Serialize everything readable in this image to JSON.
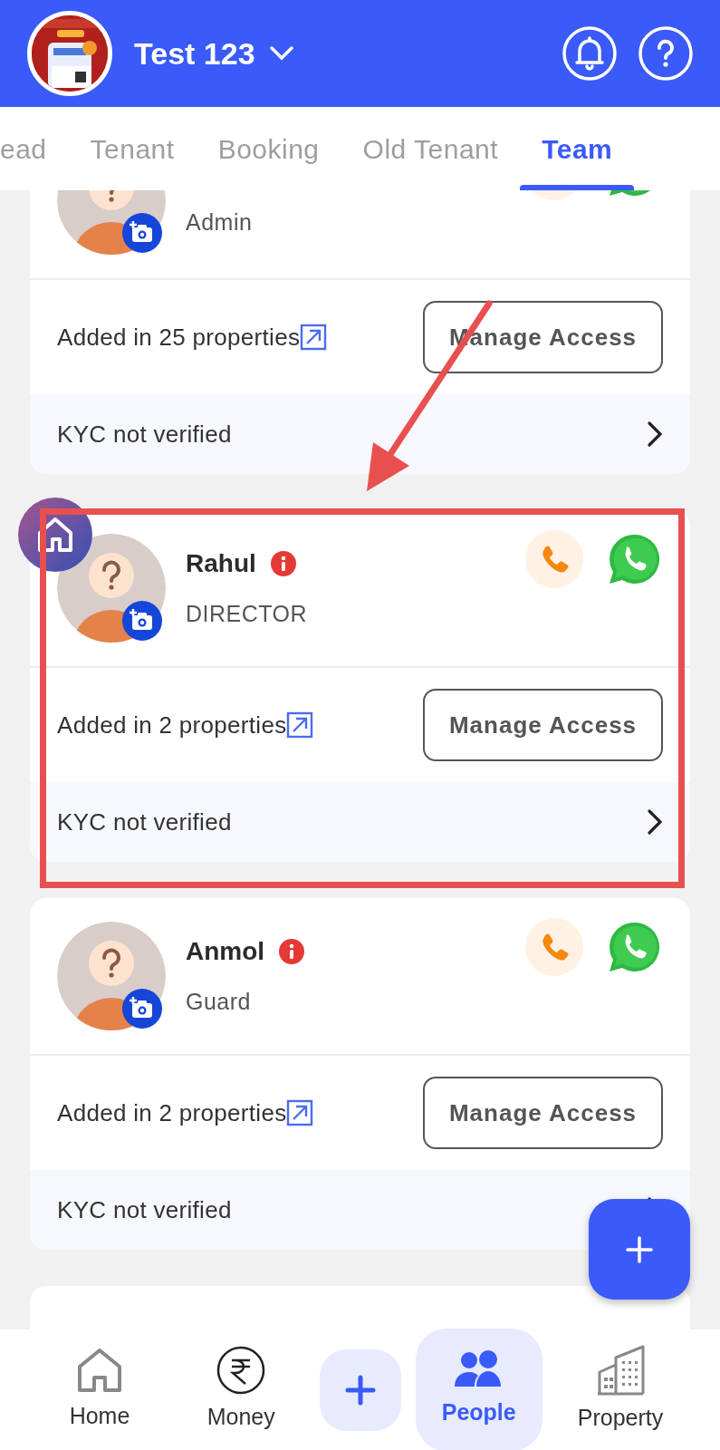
{
  "app_bar": {
    "title": "Test 123"
  },
  "tabs": [
    {
      "label": "ead",
      "selected": false
    },
    {
      "label": "Tenant",
      "selected": false
    },
    {
      "label": "Booking",
      "selected": false
    },
    {
      "label": "Old Tenant",
      "selected": false
    },
    {
      "label": "Team",
      "selected": true
    }
  ],
  "members": [
    {
      "kind": "member",
      "role": "Admin",
      "properties": "Added in 25 properties",
      "action": "Manage Access",
      "kyc": "KYC not verified"
    },
    {
      "kind": "member",
      "name": "Rahul",
      "role": "DIRECTOR",
      "properties": "Added in 2 properties",
      "action": "Manage Access",
      "kyc": "KYC not verified"
    },
    {
      "kind": "member",
      "name": "Anmol",
      "role": "Guard",
      "properties": "Added in 2 properties",
      "action": "Manage Access",
      "kyc": "KYC not verified"
    },
    {
      "kind": "stub"
    }
  ],
  "bottom_nav": [
    {
      "kind": "home",
      "label": "Home",
      "selected": false
    },
    {
      "kind": "money",
      "label": "Money",
      "selected": false
    },
    {
      "kind": "add",
      "selected": false
    },
    {
      "kind": "people",
      "label": "People",
      "selected": true
    },
    {
      "kind": "property",
      "label": "Property",
      "selected": false
    }
  ]
}
